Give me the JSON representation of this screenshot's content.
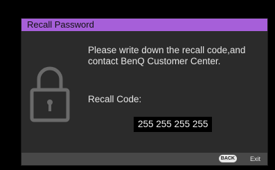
{
  "dialog": {
    "title": "Recall Password",
    "message": "Please write down the recall code,and contact BenQ Customer Center.",
    "code_label": "Recall Code:",
    "code_value": "255 255 255 255",
    "icon": "lock-icon"
  },
  "footer": {
    "back_key": "BACK",
    "exit_label": "Exit"
  },
  "colors": {
    "title_bar": "#a65fd9",
    "dialog_background": "#2b2b2b",
    "footer_background": "#484848",
    "code_background": "#000000"
  }
}
